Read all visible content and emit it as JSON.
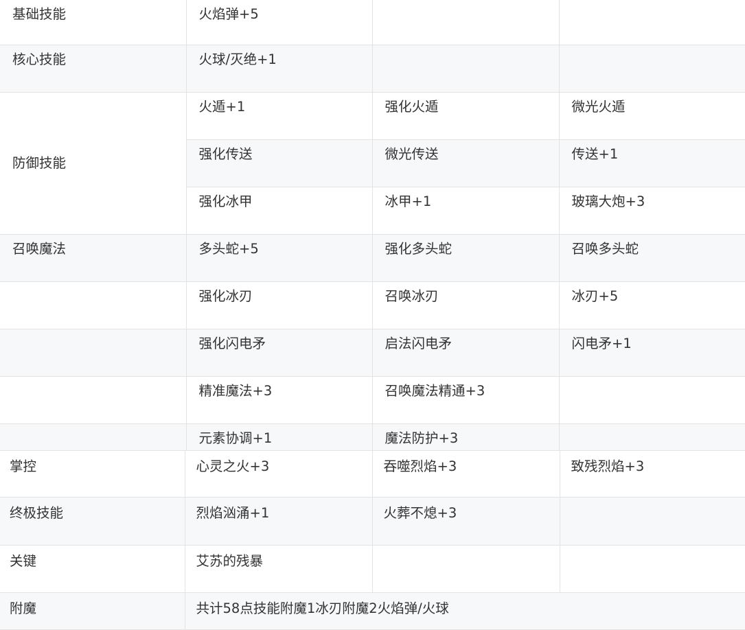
{
  "table_part1": {
    "rows": [
      [
        "基础技能",
        "火焰弹+5",
        "",
        ""
      ],
      [
        "核心技能",
        "火球/灭绝+1",
        "",
        ""
      ],
      [
        "",
        "火遁+1",
        "强化火遁",
        "微光火遁"
      ],
      [
        "",
        "强化传送",
        "微光传送",
        "传送+1"
      ],
      [
        "",
        "强化冰甲",
        "冰甲+1",
        "玻璃大炮+3"
      ],
      [
        "召唤魔法",
        "多头蛇+5",
        "强化多头蛇",
        "召唤多头蛇"
      ],
      [
        "",
        "强化冰刃",
        "召唤冰刃",
        "冰刃+5"
      ],
      [
        "",
        "强化闪电矛",
        "启法闪电矛",
        "闪电矛+1"
      ],
      [
        "",
        "精准魔法+3",
        "召唤魔法精通+3",
        ""
      ],
      [
        "",
        "元素协调+1",
        "魔法防护+3",
        ""
      ]
    ],
    "merged_label": "防御技能"
  },
  "table_part2": {
    "rows": [
      [
        "掌控",
        "心灵之火+3",
        "吞噬烈焰+3",
        "致残烈焰+3"
      ],
      [
        "终极技能",
        "烈焰汹涌+1",
        "火葬不熄+3",
        ""
      ],
      [
        "关键",
        "艾苏的残暴",
        "",
        ""
      ],
      [
        "附魔",
        "共计58点技能附魔1冰刃附魔2火焰弹/火球"
      ]
    ]
  }
}
